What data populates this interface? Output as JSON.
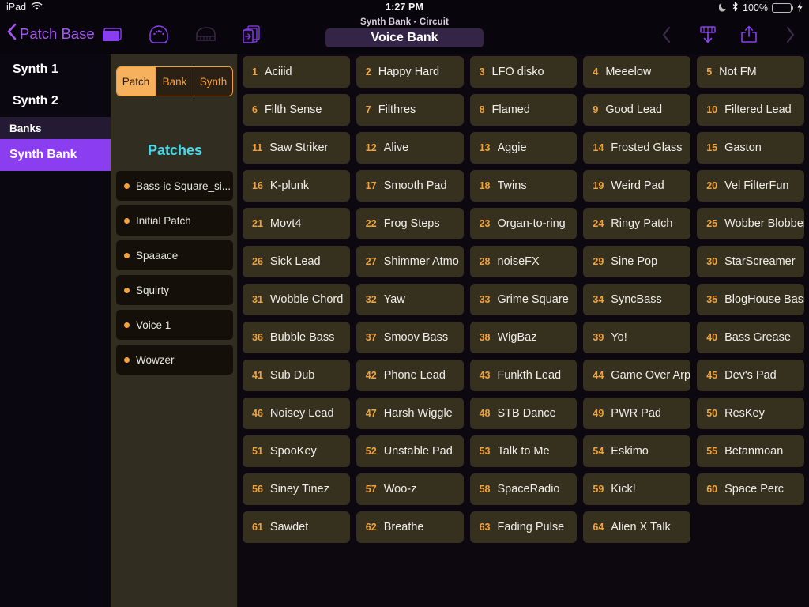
{
  "status_bar": {
    "device": "iPad",
    "wifi_icon": "wifi-icon",
    "time": "1:27 PM",
    "moon_icon": "moon-icon",
    "bluetooth_icon": "bluetooth-icon",
    "battery_percent": "100%",
    "battery_level": 100,
    "charging_icon": "lightning-bolt-icon"
  },
  "toolbar": {
    "back_label": "Patch Base",
    "back_icon": "chevron-left-icon",
    "left_icons": [
      "library-folder-icon",
      "midi-connector-icon",
      "piano-keyboard-icon",
      "documents-copy-icon"
    ],
    "subtitle": "Synth Bank - Circuit",
    "title": "Voice Bank",
    "right_icons": [
      "chevron-left-icon",
      "download-from-synth-icon",
      "share-export-icon",
      "chevron-right-icon"
    ]
  },
  "sidebar": {
    "items": [
      {
        "label": "Synth 1",
        "type": "item",
        "selected": false
      },
      {
        "label": "Synth 2",
        "type": "item",
        "selected": false
      },
      {
        "label": "Banks",
        "type": "group",
        "selected": false
      },
      {
        "label": "Synth Bank",
        "type": "selected",
        "selected": true
      }
    ]
  },
  "patch_panel": {
    "segments": [
      {
        "label": "Patch",
        "active": true
      },
      {
        "label": "Bank",
        "active": false
      },
      {
        "label": "Synth",
        "active": false
      }
    ],
    "section_title": "Patches",
    "patches": [
      "Bass-ic Square_si...",
      "Initial Patch",
      "Spaaace",
      "Squirty",
      "Voice 1",
      "Wowzer"
    ]
  },
  "voice_grid": {
    "voices": [
      {
        "num": "1",
        "name": "Aciiid"
      },
      {
        "num": "2",
        "name": "Happy Hard"
      },
      {
        "num": "3",
        "name": "LFO disko"
      },
      {
        "num": "4",
        "name": "Meeelow"
      },
      {
        "num": "5",
        "name": "Not FM"
      },
      {
        "num": "6",
        "name": "Filth Sense"
      },
      {
        "num": "7",
        "name": "Filthres"
      },
      {
        "num": "8",
        "name": "Flamed"
      },
      {
        "num": "9",
        "name": "Good Lead"
      },
      {
        "num": "10",
        "name": "Filtered Lead"
      },
      {
        "num": "11",
        "name": "Saw Striker"
      },
      {
        "num": "12",
        "name": "Alive"
      },
      {
        "num": "13",
        "name": "Aggie"
      },
      {
        "num": "14",
        "name": "Frosted Glass"
      },
      {
        "num": "15",
        "name": "Gaston"
      },
      {
        "num": "16",
        "name": "K-plunk"
      },
      {
        "num": "17",
        "name": "Smooth Pad"
      },
      {
        "num": "18",
        "name": "Twins"
      },
      {
        "num": "19",
        "name": "Weird Pad"
      },
      {
        "num": "20",
        "name": "Vel FilterFun"
      },
      {
        "num": "21",
        "name": "Movt4"
      },
      {
        "num": "22",
        "name": "Frog Steps"
      },
      {
        "num": "23",
        "name": "Organ-to-ring"
      },
      {
        "num": "24",
        "name": "Ringy Patch"
      },
      {
        "num": "25",
        "name": "Wobber Blobber"
      },
      {
        "num": "26",
        "name": "Sick Lead"
      },
      {
        "num": "27",
        "name": "Shimmer Atmo"
      },
      {
        "num": "28",
        "name": "noiseFX"
      },
      {
        "num": "29",
        "name": "Sine Pop"
      },
      {
        "num": "30",
        "name": "StarScreamer"
      },
      {
        "num": "31",
        "name": "Wobble Chord"
      },
      {
        "num": "32",
        "name": "Yaw"
      },
      {
        "num": "33",
        "name": "Grime Square"
      },
      {
        "num": "34",
        "name": "SyncBass"
      },
      {
        "num": "35",
        "name": "BlogHouse Bass"
      },
      {
        "num": "36",
        "name": "Bubble Bass"
      },
      {
        "num": "37",
        "name": "Smoov Bass"
      },
      {
        "num": "38",
        "name": "WigBaz"
      },
      {
        "num": "39",
        "name": "Yo!"
      },
      {
        "num": "40",
        "name": "Bass Grease"
      },
      {
        "num": "41",
        "name": "Sub Dub"
      },
      {
        "num": "42",
        "name": "Phone Lead"
      },
      {
        "num": "43",
        "name": "Funkth Lead"
      },
      {
        "num": "44",
        "name": "Game Over Arp"
      },
      {
        "num": "45",
        "name": "Dev's Pad"
      },
      {
        "num": "46",
        "name": "Noisey Lead"
      },
      {
        "num": "47",
        "name": "Harsh Wiggle"
      },
      {
        "num": "48",
        "name": "STB Dance"
      },
      {
        "num": "49",
        "name": "PWR Pad"
      },
      {
        "num": "50",
        "name": "ResKey"
      },
      {
        "num": "51",
        "name": "SpooKey"
      },
      {
        "num": "52",
        "name": "Unstable Pad"
      },
      {
        "num": "53",
        "name": "Talk to Me"
      },
      {
        "num": "54",
        "name": "Eskimo"
      },
      {
        "num": "55",
        "name": "Betanmoan"
      },
      {
        "num": "56",
        "name": "Siney Tinez"
      },
      {
        "num": "57",
        "name": "Woo-z"
      },
      {
        "num": "58",
        "name": "SpaceRadio"
      },
      {
        "num": "59",
        "name": "Kick!"
      },
      {
        "num": "60",
        "name": "Space Perc"
      },
      {
        "num": "61",
        "name": "Sawdet"
      },
      {
        "num": "62",
        "name": "Breathe"
      },
      {
        "num": "63",
        "name": "Fading Pulse"
      },
      {
        "num": "64",
        "name": "Alien X Talk"
      }
    ]
  },
  "colors": {
    "accent_purple": "#8b3ef0",
    "tint_purple": "#a855f7",
    "accent_orange": "#f5a13c",
    "cyan": "#4ad9e8",
    "cell_bg": "#36301f",
    "panel_bg": "#322d21",
    "app_bg": "#0d0710"
  }
}
